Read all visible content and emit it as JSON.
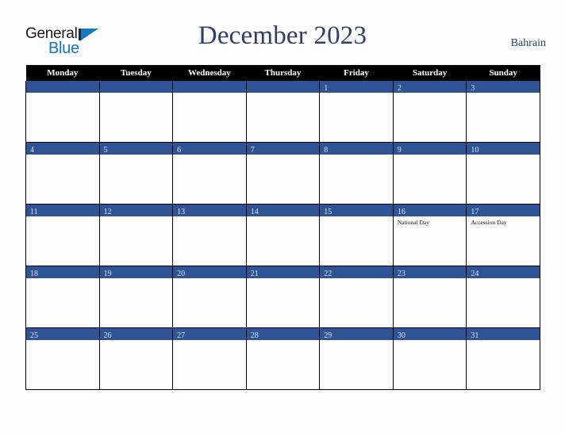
{
  "brand": {
    "name_top": "General",
    "name_bottom": "Blue",
    "accent_color": "#1479bd"
  },
  "header": {
    "title": "December 2023",
    "country": "Bahrain",
    "title_color": "#2f4064"
  },
  "calendar": {
    "weekdays": [
      "Monday",
      "Tuesday",
      "Wednesday",
      "Thursday",
      "Friday",
      "Saturday",
      "Sunday"
    ],
    "header_bg": "#000000",
    "daybar_bg": "#2f5496",
    "daynum_color": "#dde2ea",
    "weeks": [
      [
        {
          "day": "",
          "events": []
        },
        {
          "day": "",
          "events": []
        },
        {
          "day": "",
          "events": []
        },
        {
          "day": "",
          "events": []
        },
        {
          "day": "1",
          "events": []
        },
        {
          "day": "2",
          "events": []
        },
        {
          "day": "3",
          "events": []
        }
      ],
      [
        {
          "day": "4",
          "events": []
        },
        {
          "day": "5",
          "events": []
        },
        {
          "day": "6",
          "events": []
        },
        {
          "day": "7",
          "events": []
        },
        {
          "day": "8",
          "events": []
        },
        {
          "day": "9",
          "events": []
        },
        {
          "day": "10",
          "events": []
        }
      ],
      [
        {
          "day": "11",
          "events": []
        },
        {
          "day": "12",
          "events": []
        },
        {
          "day": "13",
          "events": []
        },
        {
          "day": "14",
          "events": []
        },
        {
          "day": "15",
          "events": []
        },
        {
          "day": "16",
          "events": [
            "National Day"
          ]
        },
        {
          "day": "17",
          "events": [
            "Accession Day"
          ]
        }
      ],
      [
        {
          "day": "18",
          "events": []
        },
        {
          "day": "19",
          "events": []
        },
        {
          "day": "20",
          "events": []
        },
        {
          "day": "21",
          "events": []
        },
        {
          "day": "22",
          "events": []
        },
        {
          "day": "23",
          "events": []
        },
        {
          "day": "24",
          "events": []
        }
      ],
      [
        {
          "day": "25",
          "events": []
        },
        {
          "day": "26",
          "events": []
        },
        {
          "day": "27",
          "events": []
        },
        {
          "day": "28",
          "events": []
        },
        {
          "day": "29",
          "events": []
        },
        {
          "day": "30",
          "events": []
        },
        {
          "day": "31",
          "events": []
        }
      ]
    ]
  }
}
